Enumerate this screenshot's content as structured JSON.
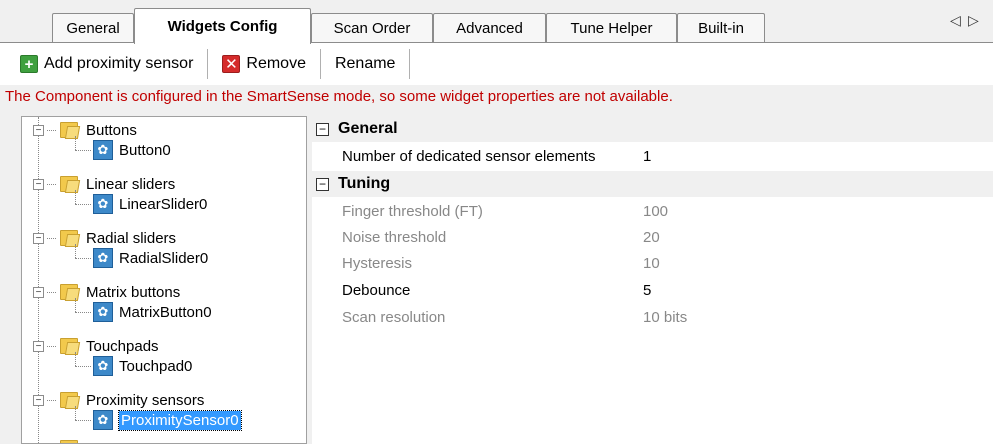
{
  "tabs": [
    {
      "label": "General",
      "active": false
    },
    {
      "label": "Widgets Config",
      "active": true
    },
    {
      "label": "Scan Order",
      "active": false
    },
    {
      "label": "Advanced",
      "active": false
    },
    {
      "label": "Tune Helper",
      "active": false
    },
    {
      "label": "Built-in",
      "active": false
    }
  ],
  "tab_scroll": {
    "left": "◁",
    "right": "▷"
  },
  "toolbar": {
    "add_label": "Add proximity sensor",
    "remove_label": "Remove",
    "rename_label": "Rename"
  },
  "warning": "The Component is configured in the SmartSense mode, so some widget properties are not available.",
  "tree": {
    "groups": [
      {
        "label": "Buttons",
        "child": "Button0"
      },
      {
        "label": "Linear sliders",
        "child": "LinearSlider0"
      },
      {
        "label": "Radial sliders",
        "child": "RadialSlider0"
      },
      {
        "label": "Matrix buttons",
        "child": "MatrixButton0"
      },
      {
        "label": "Touchpads",
        "child": "Touchpad0"
      },
      {
        "label": "Proximity sensors",
        "child": "ProximitySensor0"
      }
    ],
    "selected": "ProximitySensor0"
  },
  "properties": {
    "general": {
      "title": "General",
      "rows": [
        {
          "name": "Number of dedicated sensor elements",
          "value": "1",
          "enabled": true
        }
      ]
    },
    "tuning": {
      "title": "Tuning",
      "rows": [
        {
          "name": "Finger threshold (FT)",
          "value": "100",
          "enabled": false
        },
        {
          "name": "Noise threshold",
          "value": "20",
          "enabled": false
        },
        {
          "name": "Hysteresis",
          "value": "10",
          "enabled": false
        },
        {
          "name": "Debounce",
          "value": "5",
          "enabled": true
        },
        {
          "name": "Scan resolution",
          "value": "10 bits",
          "enabled": false
        }
      ]
    }
  },
  "colors": {
    "warning": "#c00000",
    "selection": "#3399ff"
  }
}
